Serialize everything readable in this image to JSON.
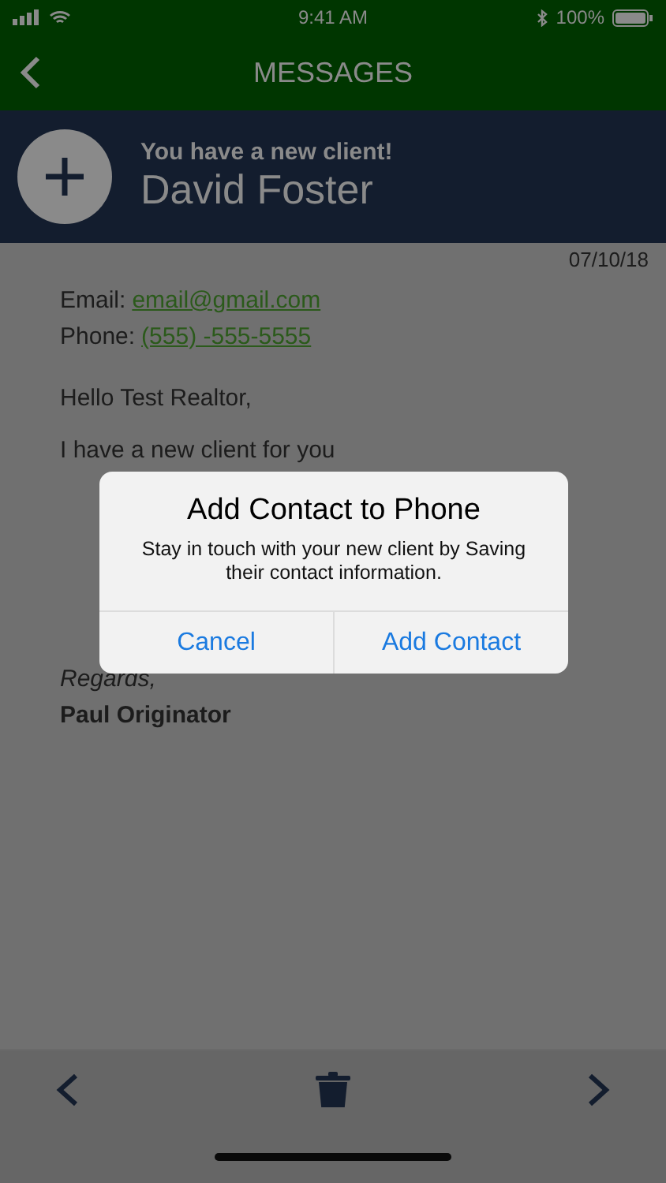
{
  "status_bar": {
    "time": "9:41 AM",
    "battery": "100%"
  },
  "nav": {
    "title": "MESSAGES"
  },
  "banner": {
    "subtitle": "You have a new client!",
    "name": "David Foster"
  },
  "message": {
    "date": "07/10/18",
    "fields": [
      {
        "label": "Email:",
        "value": "email@gmail.com"
      },
      {
        "label": "Phone:",
        "value": "(555) -555-5555"
      }
    ],
    "greeting": "Hello Test Realtor,",
    "body": "I have a new client for you",
    "closing": "Regards,",
    "signature": "Paul Originator"
  },
  "dialog": {
    "title": "Add Contact to Phone",
    "text": "Stay in touch with your new client by Saving their contact information.",
    "buttons": [
      "Cancel",
      "Add Contact"
    ]
  }
}
